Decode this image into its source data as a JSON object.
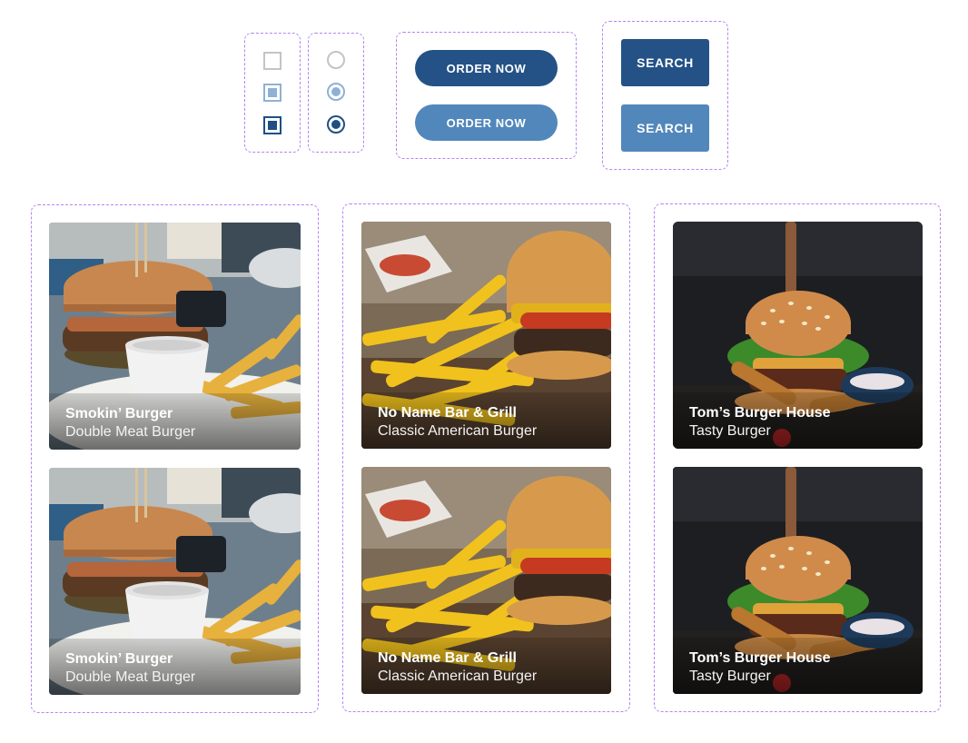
{
  "controls": {
    "checkbox_states": [
      "unchecked",
      "hover",
      "checked"
    ],
    "radio_states": [
      "unselected",
      "hover",
      "selected"
    ],
    "order_buttons": [
      {
        "label": "ORDER NOW",
        "color": "#245286"
      },
      {
        "label": "ORDER NOW",
        "color": "#5187bb"
      }
    ],
    "search_buttons": [
      {
        "label": "SEARCH",
        "color": "#245286"
      },
      {
        "label": "SEARCH",
        "color": "#5187bb"
      }
    ]
  },
  "cards": [
    {
      "restaurant": "Smokin’ Burger",
      "dish": "Double Meat Burger",
      "photo": "burger-with-fries-and-sauce-photo"
    },
    {
      "restaurant": "Smokin’ Burger",
      "dish": "Double Meat Burger",
      "photo": "burger-with-fries-and-sauce-photo"
    },
    {
      "restaurant": "No Name Bar & Grill",
      "dish": "Classic American Burger",
      "photo": "burger-and-fries-on-board-photo"
    },
    {
      "restaurant": "No Name Bar & Grill",
      "dish": "Classic American Burger",
      "photo": "burger-and-fries-on-board-photo"
    },
    {
      "restaurant": "Tom’s Burger House",
      "dish": "Tasty Burger",
      "photo": "tall-burger-with-knife-photo"
    },
    {
      "restaurant": "Tom’s Burger House",
      "dish": "Tasty Burger",
      "photo": "tall-burger-with-knife-photo"
    }
  ]
}
